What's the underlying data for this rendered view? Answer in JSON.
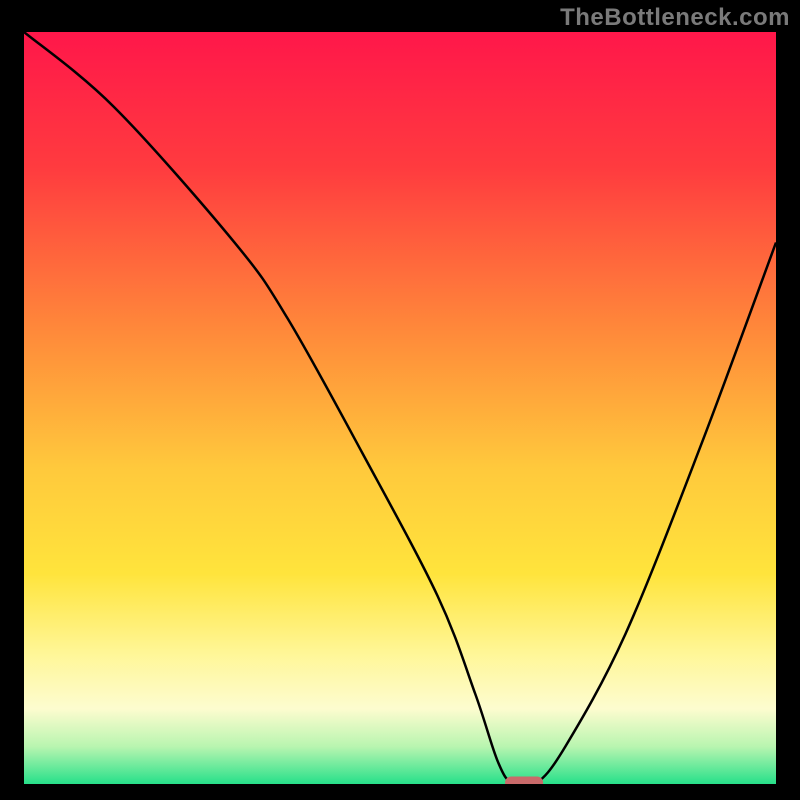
{
  "watermark": "TheBottleneck.com",
  "chart_data": {
    "type": "line",
    "title": "",
    "xlabel": "",
    "ylabel": "",
    "xlim": [
      0,
      100
    ],
    "ylim": [
      0,
      100
    ],
    "grid": false,
    "legend": false,
    "series": [
      {
        "name": "bottleneck-curve",
        "x": [
          0,
          12,
          28,
          35,
          45,
          55,
          60,
          63,
          65,
          68,
          72,
          80,
          90,
          100
        ],
        "values": [
          100,
          90,
          72,
          62,
          44,
          25,
          12,
          3,
          0,
          0,
          5,
          20,
          45,
          72
        ]
      }
    ],
    "annotations": [
      {
        "name": "optimal-marker",
        "x": 66.5,
        "y": 0,
        "shape": "pill",
        "color": "#c96a6a"
      }
    ],
    "background": {
      "type": "vertical-gradient",
      "stops": [
        {
          "pos": 0.0,
          "color": "#ff174a"
        },
        {
          "pos": 0.18,
          "color": "#ff3b3f"
        },
        {
          "pos": 0.4,
          "color": "#ff8a3a"
        },
        {
          "pos": 0.58,
          "color": "#ffc93c"
        },
        {
          "pos": 0.72,
          "color": "#ffe43c"
        },
        {
          "pos": 0.83,
          "color": "#fff79a"
        },
        {
          "pos": 0.9,
          "color": "#fdfccf"
        },
        {
          "pos": 0.95,
          "color": "#b9f5b0"
        },
        {
          "pos": 1.0,
          "color": "#27e08a"
        }
      ]
    }
  }
}
